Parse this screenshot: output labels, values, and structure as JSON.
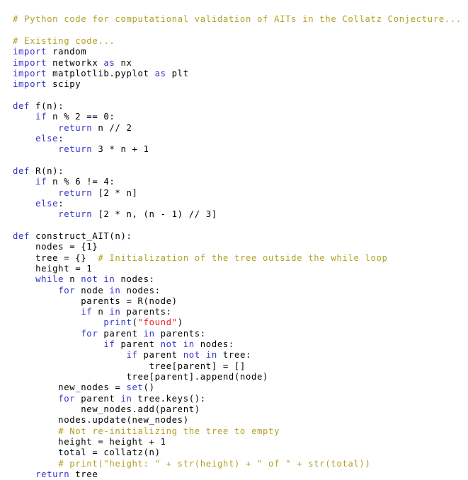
{
  "document": {
    "kind": "source-code-listing",
    "language": "Python",
    "background_color": "#ffffff"
  },
  "palette": {
    "comment": "#b3a125",
    "keyword": "#3333cc",
    "builtin": "#3333cc",
    "string": "#ee2222",
    "plain": "#000000",
    "background": "#ffffff"
  },
  "code": {
    "lines": [
      [
        {
          "t": "comment",
          "s": "# Python code for computational validation of AITs in the Collatz Conjecture..."
        }
      ],
      [
        {
          "t": "plain",
          "s": ""
        }
      ],
      [
        {
          "t": "comment",
          "s": "# Existing code..."
        }
      ],
      [
        {
          "t": "keyword",
          "s": "import"
        },
        {
          "t": "plain",
          "s": " random"
        }
      ],
      [
        {
          "t": "keyword",
          "s": "import"
        },
        {
          "t": "plain",
          "s": " networkx "
        },
        {
          "t": "keyword",
          "s": "as"
        },
        {
          "t": "plain",
          "s": " nx"
        }
      ],
      [
        {
          "t": "keyword",
          "s": "import"
        },
        {
          "t": "plain",
          "s": " matplotlib.pyplot "
        },
        {
          "t": "keyword",
          "s": "as"
        },
        {
          "t": "plain",
          "s": " plt"
        }
      ],
      [
        {
          "t": "keyword",
          "s": "import"
        },
        {
          "t": "plain",
          "s": " scipy"
        }
      ],
      [
        {
          "t": "plain",
          "s": ""
        }
      ],
      [
        {
          "t": "keyword",
          "s": "def"
        },
        {
          "t": "plain",
          "s": " f(n):"
        }
      ],
      [
        {
          "t": "plain",
          "s": "    "
        },
        {
          "t": "keyword",
          "s": "if"
        },
        {
          "t": "plain",
          "s": " n % 2 == 0:"
        }
      ],
      [
        {
          "t": "plain",
          "s": "        "
        },
        {
          "t": "keyword",
          "s": "return"
        },
        {
          "t": "plain",
          "s": " n // 2"
        }
      ],
      [
        {
          "t": "plain",
          "s": "    "
        },
        {
          "t": "keyword",
          "s": "else"
        },
        {
          "t": "plain",
          "s": ":"
        }
      ],
      [
        {
          "t": "plain",
          "s": "        "
        },
        {
          "t": "keyword",
          "s": "return"
        },
        {
          "t": "plain",
          "s": " 3 * n + 1"
        }
      ],
      [
        {
          "t": "plain",
          "s": ""
        }
      ],
      [
        {
          "t": "keyword",
          "s": "def"
        },
        {
          "t": "plain",
          "s": " R(n):"
        }
      ],
      [
        {
          "t": "plain",
          "s": "    "
        },
        {
          "t": "keyword",
          "s": "if"
        },
        {
          "t": "plain",
          "s": " n % 6 != 4:"
        }
      ],
      [
        {
          "t": "plain",
          "s": "        "
        },
        {
          "t": "keyword",
          "s": "return"
        },
        {
          "t": "plain",
          "s": " [2 * n]"
        }
      ],
      [
        {
          "t": "plain",
          "s": "    "
        },
        {
          "t": "keyword",
          "s": "else"
        },
        {
          "t": "plain",
          "s": ":"
        }
      ],
      [
        {
          "t": "plain",
          "s": "        "
        },
        {
          "t": "keyword",
          "s": "return"
        },
        {
          "t": "plain",
          "s": " [2 * n, (n - 1) // 3]"
        }
      ],
      [
        {
          "t": "plain",
          "s": ""
        }
      ],
      [
        {
          "t": "keyword",
          "s": "def"
        },
        {
          "t": "plain",
          "s": " construct_AIT(n):"
        }
      ],
      [
        {
          "t": "plain",
          "s": "    nodes = {1}"
        }
      ],
      [
        {
          "t": "plain",
          "s": "    tree = {}  "
        },
        {
          "t": "comment",
          "s": "# Initialization of the tree outside the while loop"
        }
      ],
      [
        {
          "t": "plain",
          "s": "    height = 1"
        }
      ],
      [
        {
          "t": "plain",
          "s": "    "
        },
        {
          "t": "keyword",
          "s": "while"
        },
        {
          "t": "plain",
          "s": " n "
        },
        {
          "t": "keyword",
          "s": "not"
        },
        {
          "t": "plain",
          "s": " "
        },
        {
          "t": "keyword",
          "s": "in"
        },
        {
          "t": "plain",
          "s": " nodes:"
        }
      ],
      [
        {
          "t": "plain",
          "s": "        "
        },
        {
          "t": "keyword",
          "s": "for"
        },
        {
          "t": "plain",
          "s": " node "
        },
        {
          "t": "keyword",
          "s": "in"
        },
        {
          "t": "plain",
          "s": " nodes:"
        }
      ],
      [
        {
          "t": "plain",
          "s": "            parents = R(node)"
        }
      ],
      [
        {
          "t": "plain",
          "s": "            "
        },
        {
          "t": "keyword",
          "s": "if"
        },
        {
          "t": "plain",
          "s": " n "
        },
        {
          "t": "keyword",
          "s": "in"
        },
        {
          "t": "plain",
          "s": " parents:"
        }
      ],
      [
        {
          "t": "plain",
          "s": "                "
        },
        {
          "t": "builtin",
          "s": "print"
        },
        {
          "t": "plain",
          "s": "("
        },
        {
          "t": "string",
          "s": "\"found\""
        },
        {
          "t": "plain",
          "s": ")"
        }
      ],
      [
        {
          "t": "plain",
          "s": "            "
        },
        {
          "t": "keyword",
          "s": "for"
        },
        {
          "t": "plain",
          "s": " parent "
        },
        {
          "t": "keyword",
          "s": "in"
        },
        {
          "t": "plain",
          "s": " parents:"
        }
      ],
      [
        {
          "t": "plain",
          "s": "                "
        },
        {
          "t": "keyword",
          "s": "if"
        },
        {
          "t": "plain",
          "s": " parent "
        },
        {
          "t": "keyword",
          "s": "not"
        },
        {
          "t": "plain",
          "s": " "
        },
        {
          "t": "keyword",
          "s": "in"
        },
        {
          "t": "plain",
          "s": " nodes:"
        }
      ],
      [
        {
          "t": "plain",
          "s": "                    "
        },
        {
          "t": "keyword",
          "s": "if"
        },
        {
          "t": "plain",
          "s": " parent "
        },
        {
          "t": "keyword",
          "s": "not"
        },
        {
          "t": "plain",
          "s": " "
        },
        {
          "t": "keyword",
          "s": "in"
        },
        {
          "t": "plain",
          "s": " tree:"
        }
      ],
      [
        {
          "t": "plain",
          "s": "                        tree[parent] = []"
        }
      ],
      [
        {
          "t": "plain",
          "s": "                    tree[parent].append(node)"
        }
      ],
      [
        {
          "t": "plain",
          "s": "        new_nodes = "
        },
        {
          "t": "builtin",
          "s": "set"
        },
        {
          "t": "plain",
          "s": "()"
        }
      ],
      [
        {
          "t": "plain",
          "s": "        "
        },
        {
          "t": "keyword",
          "s": "for"
        },
        {
          "t": "plain",
          "s": " parent "
        },
        {
          "t": "keyword",
          "s": "in"
        },
        {
          "t": "plain",
          "s": " tree.keys():"
        }
      ],
      [
        {
          "t": "plain",
          "s": "            new_nodes.add(parent)"
        }
      ],
      [
        {
          "t": "plain",
          "s": "        nodes.update(new_nodes)"
        }
      ],
      [
        {
          "t": "plain",
          "s": "        "
        },
        {
          "t": "comment",
          "s": "# Not re-initializing the tree to empty"
        }
      ],
      [
        {
          "t": "plain",
          "s": "        height = height + 1"
        }
      ],
      [
        {
          "t": "plain",
          "s": "        total = collatz(n)"
        }
      ],
      [
        {
          "t": "plain",
          "s": "        "
        },
        {
          "t": "comment",
          "s": "# print(\"height: \" + str(height) + \" of \" + str(total))"
        }
      ],
      [
        {
          "t": "plain",
          "s": "    "
        },
        {
          "t": "keyword",
          "s": "return"
        },
        {
          "t": "plain",
          "s": " tree"
        }
      ]
    ]
  }
}
